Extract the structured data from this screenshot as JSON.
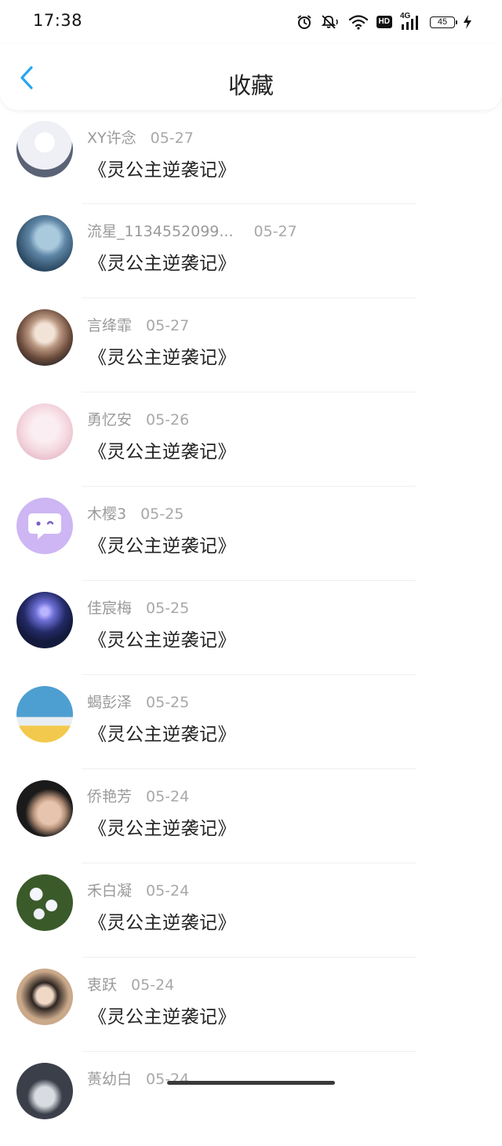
{
  "status_bar": {
    "time": "17:38",
    "hd_label": "HD",
    "network": "4G",
    "battery": "45",
    "icons": [
      "alarm-icon",
      "mute-icon",
      "wifi-icon",
      "hd-icon",
      "signal-icon",
      "battery-icon",
      "charging-icon"
    ]
  },
  "nav": {
    "title": "收藏",
    "back_icon": "chevron-left-icon",
    "accent_color": "#2aa5f0"
  },
  "items": [
    {
      "user": "XY许念",
      "date": "05-27",
      "book": "《灵公主逆袭记》",
      "avatar_colors": [
        "#eef0f6",
        "#5a6275"
      ]
    },
    {
      "user": "流星_1134552099...",
      "date": "05-27",
      "book": "《灵公主逆袭记》",
      "avatar_colors": [
        "#2c4a63",
        "#a9c9dc"
      ]
    },
    {
      "user": "言绛霏",
      "date": "05-27",
      "book": "《灵公主逆袭记》",
      "avatar_colors": [
        "#6b4b3b",
        "#e7d2c1"
      ]
    },
    {
      "user": "勇忆安",
      "date": "05-26",
      "book": "《灵公主逆袭记》",
      "avatar_colors": [
        "#f4d7df",
        "#fbeef2"
      ]
    },
    {
      "user": "木樱3",
      "date": "05-25",
      "book": "《灵公主逆袭记》",
      "avatar_colors": [
        "#cdb6f3",
        "#ffffff"
      ]
    },
    {
      "user": "佳宸梅",
      "date": "05-25",
      "book": "《灵公主逆袭记》",
      "avatar_colors": [
        "#141a3c",
        "#6e6fd6"
      ]
    },
    {
      "user": "蝎彭泽",
      "date": "05-25",
      "book": "《灵公主逆袭记》",
      "avatar_colors": [
        "#4e9fd1",
        "#f2c94c"
      ]
    },
    {
      "user": "侨艳芳",
      "date": "05-24",
      "book": "《灵公主逆袭记》",
      "avatar_colors": [
        "#1a1a1a",
        "#e6c4ad"
      ]
    },
    {
      "user": "禾白凝",
      "date": "05-24",
      "book": "《灵公主逆袭记》",
      "avatar_colors": [
        "#3b5a2a",
        "#f4f6fb"
      ]
    },
    {
      "user": "衷跃",
      "date": "05-24",
      "book": "《灵公主逆袭记》",
      "avatar_colors": [
        "#caa98b",
        "#2d2520"
      ]
    },
    {
      "user": "蒉幼白",
      "date": "05-24",
      "book": "",
      "avatar_colors": [
        "#3a3f4a",
        "#d8dbe0"
      ]
    }
  ]
}
